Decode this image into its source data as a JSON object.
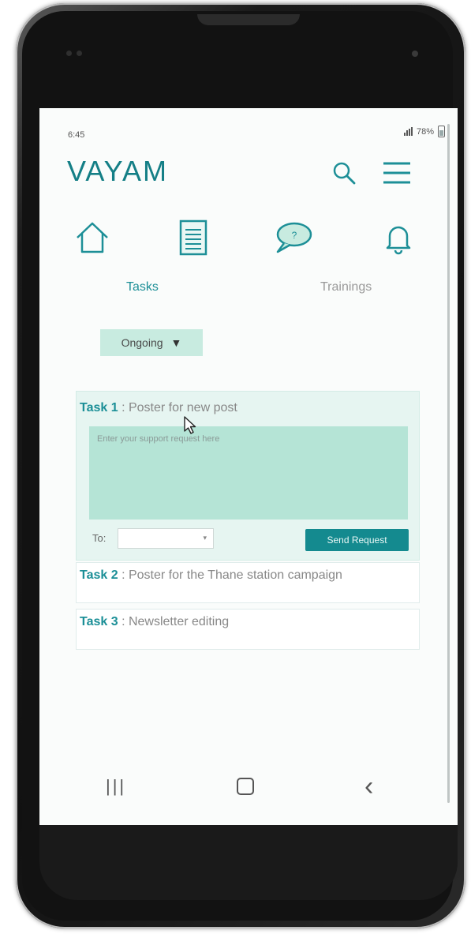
{
  "status_bar": {
    "time": "6:45",
    "battery": "78%"
  },
  "header": {
    "logo": "VAYAM",
    "icons": [
      "search-icon",
      "menu-icon"
    ]
  },
  "nav": {
    "icons": [
      "home-icon",
      "tasks-document-icon",
      "chat-question-icon",
      "bell-icon"
    ]
  },
  "tabs": {
    "tasks": "Tasks",
    "trainings": "Trainings"
  },
  "filter": {
    "selected": "Ongoing",
    "arrow": "▼"
  },
  "tasks": [
    {
      "label": "Task 1",
      "separator": " : ",
      "title": "Poster for new post"
    },
    {
      "label": "Task 2",
      "separator": " : ",
      "title": "Poster for the Thane station campaign"
    },
    {
      "label": "Task 3",
      "separator": " : ",
      "title": "Newsletter editing"
    }
  ],
  "support_request": {
    "placeholder": "Enter your support request here",
    "to_label": "To:",
    "send_label": "Send Request"
  },
  "colors": {
    "accent": "#147f86",
    "card_bg": "#e6f5f1",
    "input_bg": "#b5e4d6",
    "button_bg": "#148a8f"
  }
}
